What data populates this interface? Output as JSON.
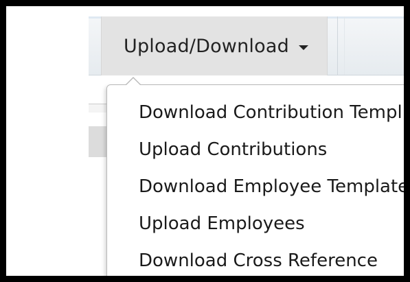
{
  "menu": {
    "trigger_label": "Upload/Download",
    "trigger_icon": "caret-down-icon",
    "items": [
      {
        "label": "Download Contribution Templ"
      },
      {
        "label": "Upload Contributions"
      },
      {
        "label": "Download Employee Template"
      },
      {
        "label": "Upload Employees"
      },
      {
        "label": "Download Cross Reference"
      }
    ]
  },
  "colors": {
    "frame_border": "#000000",
    "tab_background": "#e3e3e3",
    "text": "#1a1a1a"
  }
}
